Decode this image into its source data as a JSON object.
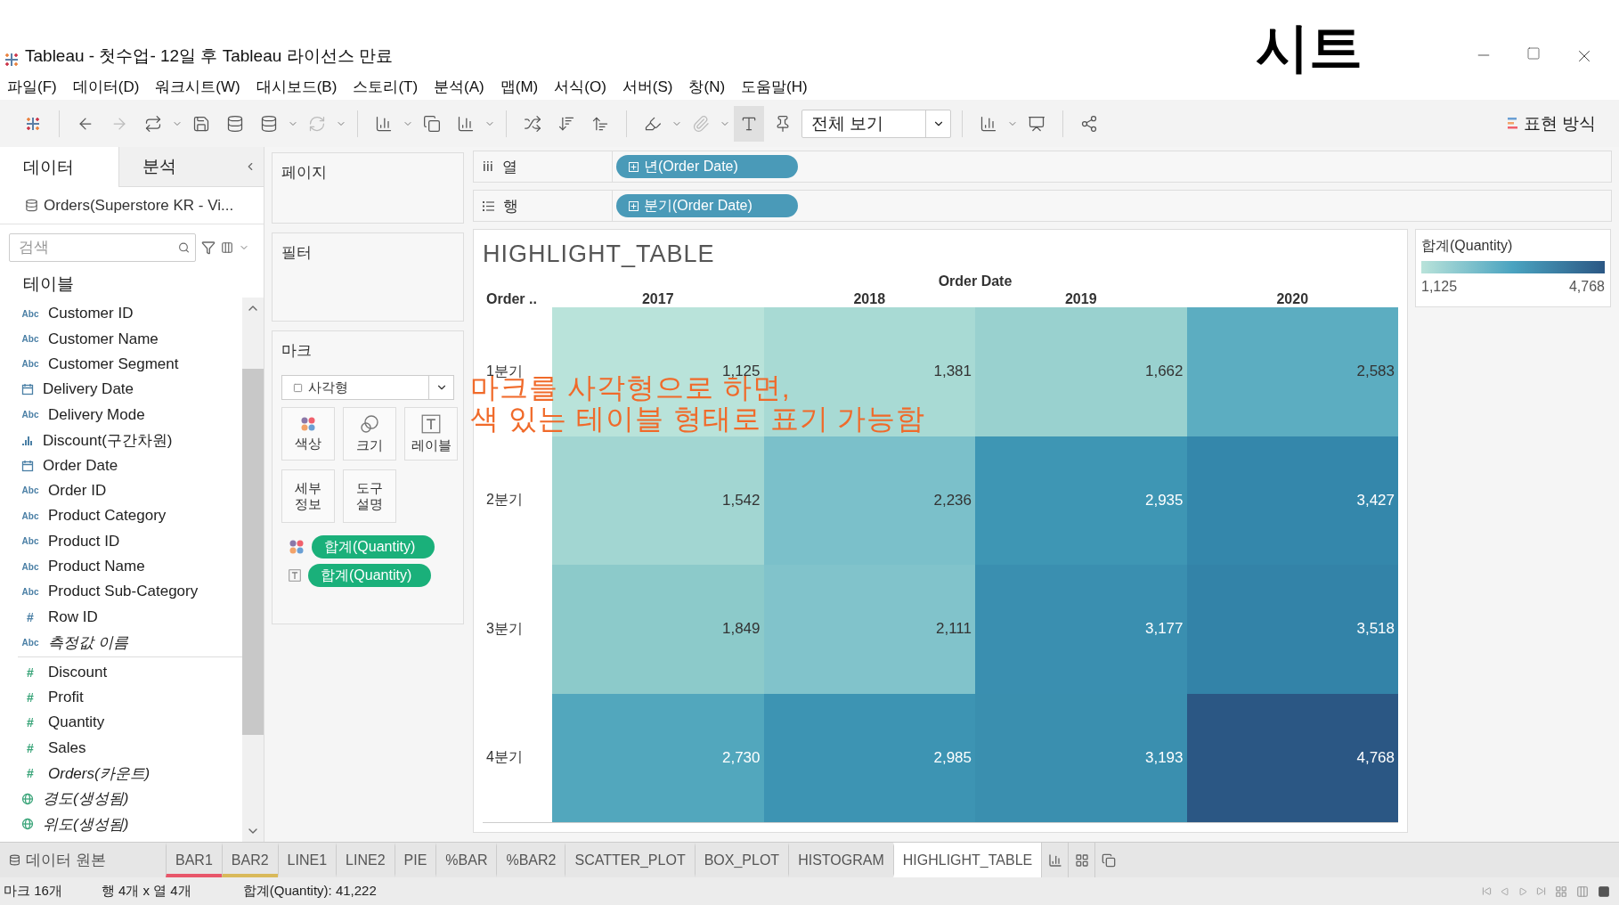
{
  "window": {
    "title": "Tableau - 첫수업- 12일 후 Tableau 라이선스 만료",
    "overlay_title": "시트"
  },
  "menu": [
    "파일(F)",
    "데이터(D)",
    "워크시트(W)",
    "대시보드(B)",
    "스토리(T)",
    "분석(A)",
    "맵(M)",
    "서식(O)",
    "서버(S)",
    "창(N)",
    "도움말(H)"
  ],
  "toolbar": {
    "view_select": "전체 보기",
    "show_me": "표현 방식"
  },
  "data_pane": {
    "tabs": [
      {
        "label": "데이터",
        "selected": true
      },
      {
        "label": "분석",
        "selected": false
      }
    ],
    "datasource": "Orders(Superstore KR - Vi...",
    "search": {
      "placeholder": "검색"
    },
    "section": "테이블",
    "groups": [
      {
        "kind": "dimension",
        "fields": [
          {
            "name": "Customer ID",
            "kind": "string",
            "glyph": "Abc",
            "italic": false
          },
          {
            "name": "Customer Name",
            "kind": "string",
            "glyph": "Abc",
            "italic": false
          },
          {
            "name": "Customer Segment",
            "kind": "string",
            "glyph": "Abc",
            "italic": false
          },
          {
            "name": "Delivery Date",
            "kind": "date",
            "italic": false
          },
          {
            "name": "Delivery Mode",
            "kind": "string",
            "glyph": "Abc",
            "italic": false
          },
          {
            "name": "Discount(구간차원)",
            "kind": "bin",
            "italic": false
          },
          {
            "name": "Order Date",
            "kind": "date",
            "italic": false
          },
          {
            "name": "Order ID",
            "kind": "string",
            "glyph": "Abc",
            "italic": false
          },
          {
            "name": "Product Category",
            "kind": "string",
            "glyph": "Abc",
            "italic": false
          },
          {
            "name": "Product ID",
            "kind": "string",
            "glyph": "Abc",
            "italic": false
          },
          {
            "name": "Product Name",
            "kind": "string",
            "glyph": "Abc",
            "italic": false
          },
          {
            "name": "Product Sub-Category",
            "kind": "string",
            "glyph": "Abc",
            "italic": false
          },
          {
            "name": "Row ID",
            "kind": "number",
            "glyph": "#",
            "italic": false
          },
          {
            "name": "측정값 이름",
            "kind": "string",
            "glyph": "Abc",
            "italic": true
          }
        ]
      },
      {
        "kind": "measure",
        "fields": [
          {
            "name": "Discount",
            "kind": "number",
            "glyph": "#",
            "italic": false
          },
          {
            "name": "Profit",
            "kind": "number",
            "glyph": "#",
            "italic": false
          },
          {
            "name": "Quantity",
            "kind": "number",
            "glyph": "#",
            "italic": false
          },
          {
            "name": "Sales",
            "kind": "number",
            "glyph": "#",
            "italic": false
          },
          {
            "name": "Orders(카운트)",
            "kind": "number",
            "glyph": "#",
            "italic": true
          },
          {
            "name": "경도(생성됨)",
            "kind": "geo",
            "italic": true
          },
          {
            "name": "위도(생성됨)",
            "kind": "geo",
            "italic": true
          }
        ]
      }
    ]
  },
  "cards": {
    "pages": "페이지",
    "filters": "필터",
    "marks": {
      "title": "마크",
      "mark_type": "사각형",
      "buttons": [
        {
          "label": "색상",
          "kind": "color"
        },
        {
          "label": "크기",
          "kind": "size"
        },
        {
          "label": "레이블",
          "kind": "label"
        },
        {
          "label": "세부\n정보",
          "kind": "detail"
        },
        {
          "label": "도구\n설명",
          "kind": "tooltip"
        }
      ],
      "pills": [
        {
          "label": "합계(Quantity)",
          "kind": "color"
        },
        {
          "label": "합계(Quantity)",
          "kind": "label"
        }
      ]
    }
  },
  "shelves": [
    {
      "label": "열",
      "kind": "columns",
      "pill": "년(Order Date)"
    },
    {
      "label": "행",
      "kind": "rows",
      "pill": "분기(Order Date)"
    }
  ],
  "view": {
    "title": "HIGHLIGHT_TABLE",
    "column_header": "Order Date",
    "row_header": "Order ..",
    "columns": [
      "2017",
      "2018",
      "2019",
      "2020"
    ],
    "rows": [
      {
        "label": "1분기",
        "cells": [
          {
            "text": "1,125",
            "color": "#b9e3da"
          },
          {
            "text": "1,381",
            "color": "#a8dad4"
          },
          {
            "text": "1,662",
            "color": "#99d1cf"
          },
          {
            "text": "2,583",
            "color": "#5cadc1"
          }
        ]
      },
      {
        "label": "2분기",
        "cells": [
          {
            "text": "1,542",
            "color": "#a2d6d2"
          },
          {
            "text": "2,236",
            "color": "#7bc0ca"
          },
          {
            "text": "2,935",
            "color": "#3e96b4"
          },
          {
            "text": "3,427",
            "color": "#3487ab"
          }
        ]
      },
      {
        "label": "3분기",
        "cells": [
          {
            "text": "1,849",
            "color": "#8ccaca"
          },
          {
            "text": "2,111",
            "color": "#81c3cb"
          },
          {
            "text": "3,177",
            "color": "#3a8fb0"
          },
          {
            "text": "3,518",
            "color": "#3383a8"
          }
        ]
      },
      {
        "label": "4분기",
        "cells": [
          {
            "text": "2,730",
            "color": "#52a7bd"
          },
          {
            "text": "2,985",
            "color": "#3d94b3"
          },
          {
            "text": "3,193",
            "color": "#3a8faf"
          },
          {
            "text": "4,768",
            "color": "#2b5784"
          }
        ]
      }
    ],
    "annotation": [
      "마크를 사각형으로 하면,",
      "색 있는 테이블 형태로 표기 가능함"
    ]
  },
  "legend": {
    "title": "합계(Quantity)",
    "min": "1,125",
    "max": "4,768"
  },
  "sheet_tabs": {
    "datasource": "데이터 원본",
    "tabs": [
      {
        "label": "BAR1",
        "selected": false,
        "color": "#e8566a"
      },
      {
        "label": "BAR2",
        "selected": false,
        "color": "#d9b95a"
      },
      {
        "label": "LINE1",
        "selected": false
      },
      {
        "label": "LINE2",
        "selected": false
      },
      {
        "label": "PIE",
        "selected": false
      },
      {
        "label": "%BAR",
        "selected": false
      },
      {
        "label": "%BAR2",
        "selected": false
      },
      {
        "label": "SCATTER_PLOT",
        "selected": false
      },
      {
        "label": "BOX_PLOT",
        "selected": false
      },
      {
        "label": "HISTOGRAM",
        "selected": false
      },
      {
        "label": "HIGHLIGHT_TABLE",
        "selected": true
      }
    ]
  },
  "status_bar": [
    "마크 16개",
    "행 4개 x 열 4개",
    "합계(Quantity): 41,222"
  ]
}
